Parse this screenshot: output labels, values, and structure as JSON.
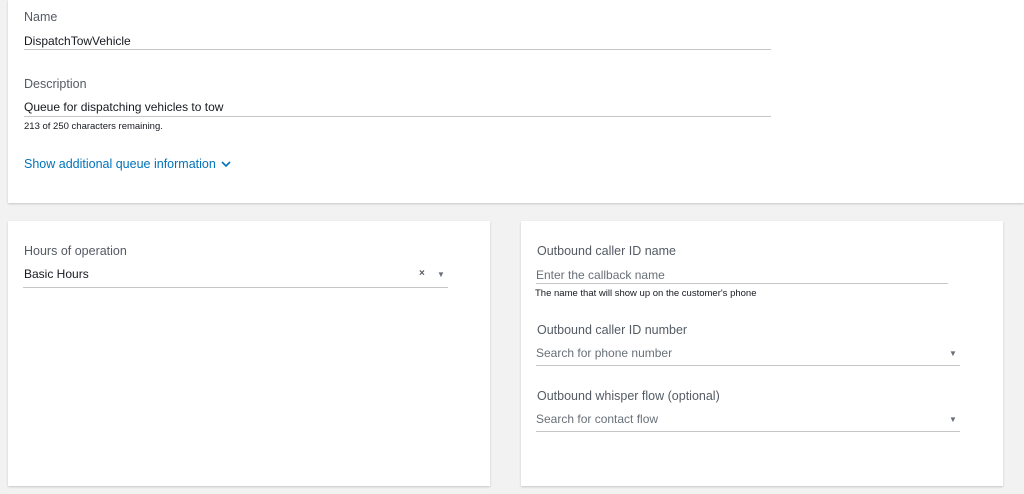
{
  "queue": {
    "name_label": "Name",
    "name_value": "DispatchTowVehicle",
    "description_label": "Description",
    "description_value": "Queue for dispatching vehicles to tow",
    "description_hint": "213 of 250 characters remaining.",
    "show_more_link": "Show additional queue information",
    "show_more_icon": "chevron-down-icon"
  },
  "hours": {
    "label": "Hours of operation",
    "selected": "Basic Hours",
    "clear_glyph": "×",
    "caret_glyph": "▼"
  },
  "outbound": {
    "caller_name_label": "Outbound caller ID name",
    "caller_name_placeholder": "Enter the callback name",
    "caller_name_hint": "The name that will show up on the customer's phone",
    "caller_number_label": "Outbound caller ID number",
    "caller_number_placeholder": "Search for phone number",
    "whisper_label": "Outbound whisper flow (optional)",
    "whisper_placeholder": "Search for contact flow",
    "caret_glyph": "▼"
  },
  "colors": {
    "link": "#0073bb",
    "background": "#f2f2f2",
    "panel": "#ffffff"
  }
}
